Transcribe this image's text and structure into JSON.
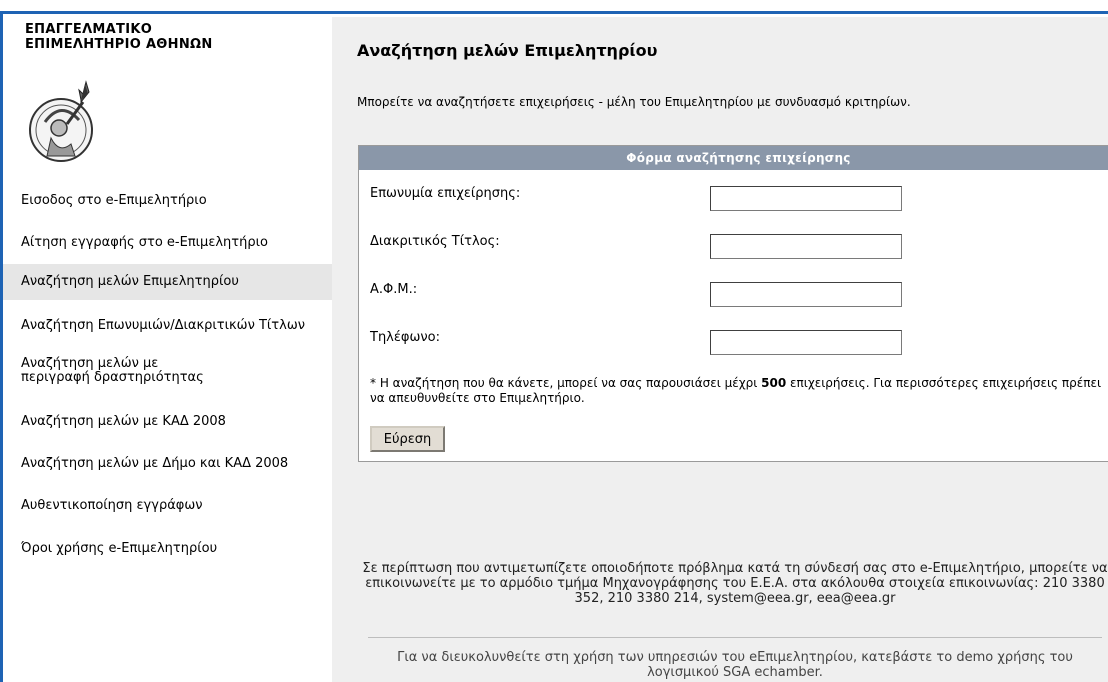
{
  "org": {
    "name_line1": "ΕΠΑΓΓΕΛΜΑΤΙΚΟ",
    "name_line2": "ΕΠΙΜΕΛΗΤΗΡΙΟ ΑΘΗΝΩΝ",
    "seal_icon": "athena-seal-icon"
  },
  "nav": {
    "items": [
      {
        "label": "Εισοδος στο e-Επιμελητήριο"
      },
      {
        "label": "Αίτηση εγγραφής στο e-Επιμελητήριο"
      },
      {
        "label": "Αναζήτηση μελών Επιμελητηρίου",
        "active": true
      },
      {
        "label": "Αναζήτηση Επωνυμιών/Διακριτικών Τίτλων"
      },
      {
        "label_line1": "Αναζήτηση μελών με",
        "label_line2": "περιγραφή δραστηριότητας"
      },
      {
        "label": "Αναζήτηση μελών με ΚΑΔ 2008"
      },
      {
        "label": "Αναζήτηση μελών με Δήμο και ΚΑΔ 2008"
      },
      {
        "label": "Αυθεντικοποίηση εγγράφων"
      },
      {
        "label": "Όροι χρήσης e-Επιμελητηρίου"
      }
    ]
  },
  "main": {
    "title": "Αναζήτηση μελών Επιμελητηρίου",
    "intro": "Μπορείτε να αναζητήσετε επιχειρήσεις - μέλη του Επιμελητηρίου με συνδυασμό κριτηρίων."
  },
  "form": {
    "header": "Φόρμα αναζήτησης επιχείρησης",
    "fields": [
      {
        "label": "Επωνυμία επιχείρησης:",
        "value": ""
      },
      {
        "label": "Διακριτικός Τίτλος:",
        "value": ""
      },
      {
        "label": "Α.Φ.Μ.:",
        "value": ""
      },
      {
        "label": "Τηλέφωνο:",
        "value": ""
      }
    ],
    "note_before": "* Η αναζήτηση που θα κάνετε, μπορεί να σας παρουσιάσει μέχρι ",
    "note_limit": "500",
    "note_after": " επιχειρήσεις. Για περισσότερες επιχειρήσεις πρέπει να απευθυνθείτε στο Επιμελητήριο.",
    "submit_label": "Εύρεση"
  },
  "footer": {
    "contact_text": "Σε περίπτωση που αντιμετωπίζετε οποιοδήποτε πρόβλημα κατά τη σύνδεσή σας στο e-Επιμελητήριο, μπορείτε να επικοινωνείτε με το αρμόδιο τμήμα Μηχανογράφησης του Ε.Ε.Α. στα ακόλουθα στοιχεία επικοινωνίας: 210 3380 352, 210 3380 214, system@eea.gr, eea@eea.gr",
    "demo_text": "Για να διευκολυνθείτε στη χρήση των υπηρεσιών του eΕπιμελητηρίου, κατεβάστε το demo χρήσης του λογισμικού SGA echamber."
  }
}
